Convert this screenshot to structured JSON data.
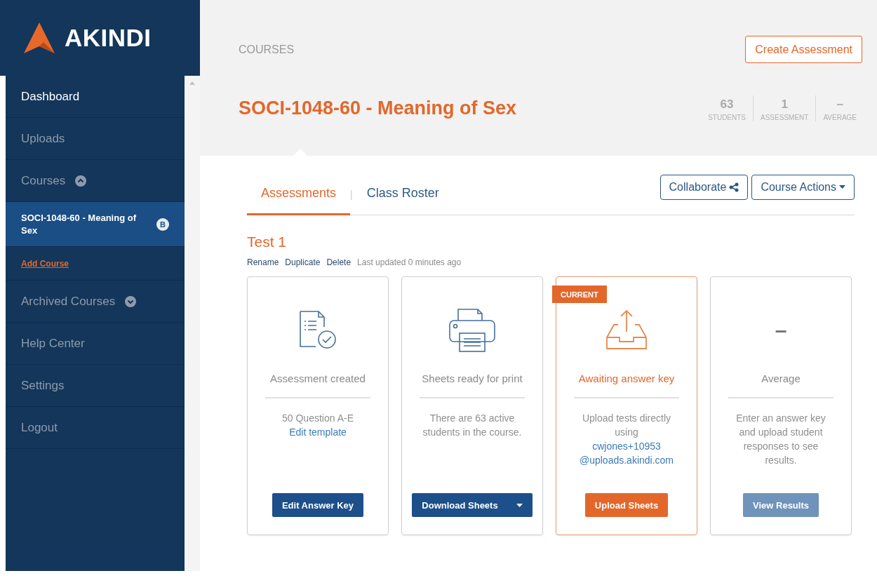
{
  "brand": {
    "name": "AKINDI"
  },
  "sidebar": {
    "items": [
      {
        "kind": "item",
        "label": "Dashboard",
        "active": true
      },
      {
        "kind": "item",
        "label": "Uploads",
        "active": false
      },
      {
        "kind": "group",
        "label": "Courses",
        "expanded": true
      },
      {
        "kind": "course",
        "label": "SOCI-1048-60 - Meaning of Sex",
        "badge": "B",
        "selected": true
      },
      {
        "kind": "link",
        "label": "Add Course"
      },
      {
        "kind": "group",
        "label": "Archived Courses",
        "expanded": false
      },
      {
        "kind": "item",
        "label": "Help Center",
        "active": false
      },
      {
        "kind": "item",
        "label": "Settings",
        "active": false
      },
      {
        "kind": "item",
        "label": "Logout",
        "active": false
      }
    ]
  },
  "header": {
    "breadcrumb": "COURSES",
    "create_button": "Create Assessment",
    "title": "SOCI-1048-60 - Meaning of Sex",
    "stats": [
      {
        "value": "63",
        "label": "STUDENTS"
      },
      {
        "value": "1",
        "label": "ASSESSMENT"
      },
      {
        "value": "–",
        "label": "AVERAGE"
      }
    ]
  },
  "tabs": [
    {
      "label": "Assessments",
      "selected": true
    },
    {
      "label": "Class Roster",
      "selected": false
    }
  ],
  "tab_separator": "|",
  "actions": [
    {
      "label": "Collaborate"
    },
    {
      "label": "Course Actions"
    }
  ],
  "assessment": {
    "title": "Test 1",
    "links": [
      "Rename",
      "Duplicate",
      "Delete"
    ],
    "updated": "Last updated 0 minutes ago"
  },
  "cards": [
    {
      "kind": "created",
      "current": false,
      "title": "Assessment created",
      "text": "50 Question A-E",
      "link": "Edit template",
      "button": {
        "label": "Edit Answer Key",
        "dropdown": false,
        "disabled": false
      }
    },
    {
      "kind": "print",
      "current": false,
      "title": "Sheets ready for print",
      "text": "There are 63 active students in the course.",
      "button": {
        "label": "Download Sheets",
        "dropdown": true,
        "disabled": false
      }
    },
    {
      "kind": "upload",
      "current": true,
      "badge": "CURRENT",
      "title": "Awaiting answer key",
      "text": "Upload tests directly using",
      "link": "cwjones+10953 @uploads.akindi.com",
      "button": {
        "label": "Upload Sheets",
        "dropdown": false,
        "disabled": false
      }
    },
    {
      "kind": "average",
      "current": false,
      "value": "–",
      "title": "Average",
      "text": "Enter an answer key and upload student responses to see results.",
      "button": {
        "label": "View Results",
        "dropdown": false,
        "disabled": true
      }
    }
  ]
}
